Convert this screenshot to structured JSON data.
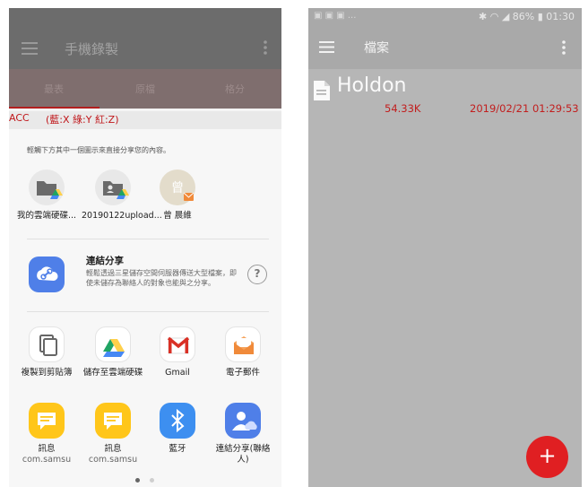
{
  "left": {
    "app_title": "手機錄製",
    "tabs": [
      "最表",
      "原檔",
      "格分"
    ],
    "acc_label": "ACC",
    "acc_axes": "(藍:X 綠:Y 紅:Z)",
    "share_hint": "輕觸下方其中一個圖示來直接分享您的內容。",
    "direct_share": [
      {
        "label": "我的雲端硬碟...",
        "icon": "drive-folder-icon"
      },
      {
        "label": "20190122upload...",
        "icon": "drive-contact-folder-icon"
      },
      {
        "label": "曾 晨維",
        "icon": "contact-avatar-icon"
      }
    ],
    "link_share": {
      "title": "連結分享",
      "description": "輕鬆透過三星儲存空間伺服器傳送大型檔案，即使未儲存為聯絡人的對象也能與之分享。",
      "help": "?"
    },
    "apps": [
      {
        "label": "複製到剪貼簿",
        "sub": "",
        "icon": "copy-icon"
      },
      {
        "label": "儲存至雲端硬碟",
        "sub": "",
        "icon": "google-drive-icon"
      },
      {
        "label": "Gmail",
        "sub": "",
        "icon": "gmail-icon"
      },
      {
        "label": "電子郵件",
        "sub": "",
        "icon": "email-icon"
      },
      {
        "label": "訊息",
        "sub": "com.samsu",
        "icon": "message-icon"
      },
      {
        "label": "訊息",
        "sub": "com.samsu",
        "icon": "message-icon"
      },
      {
        "label": "藍牙",
        "sub": "",
        "icon": "bluetooth-icon"
      },
      {
        "label": "連結分享(聯絡人)",
        "sub": "",
        "icon": "link-share-contact-icon"
      }
    ],
    "page_indicator": {
      "pages": 2,
      "current": 1
    }
  },
  "right": {
    "status": {
      "left_icons": "▣ ▣ ▣ ...",
      "battery": "86%",
      "time": "01:30"
    },
    "app_title": "檔案",
    "file": {
      "name": "Holdon",
      "size": "54.33K",
      "date": "2019/02/21 01:29:53"
    },
    "fab_label": "+"
  },
  "colors": {
    "accent_red": "#e01f22",
    "file_meta_red": "#c21e1e",
    "drive_green": "#1fa463",
    "drive_yellow": "#ffd04b",
    "drive_blue": "#4688f4",
    "message_yellow": "#ffc61a",
    "bluetooth_blue": "#3d8ff0",
    "link_blue": "#4f7fe8"
  }
}
